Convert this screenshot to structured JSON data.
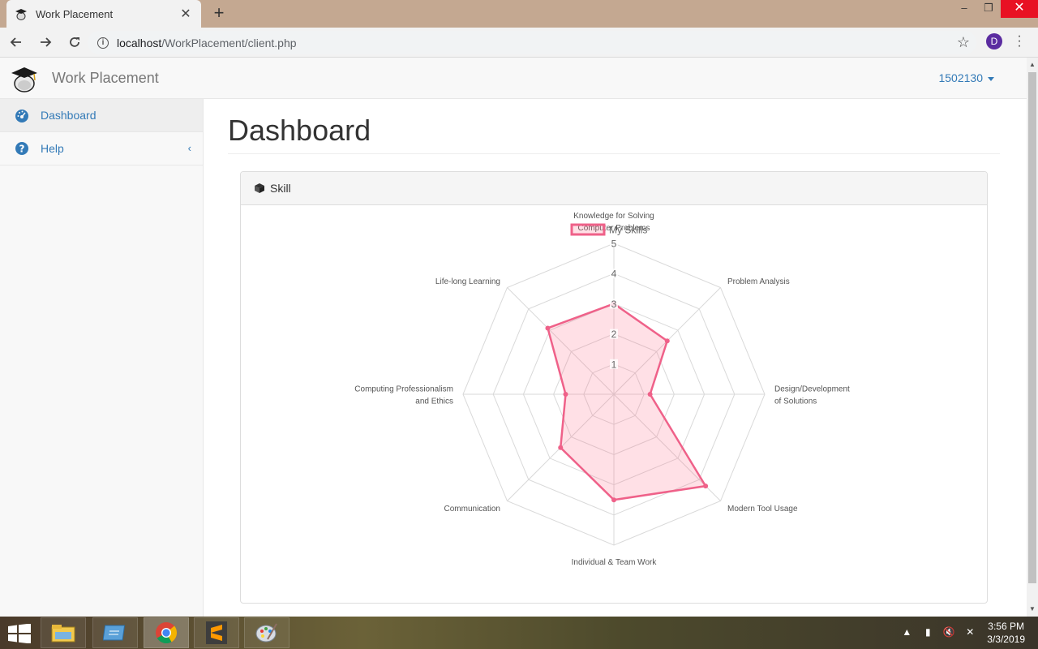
{
  "browser": {
    "tab_title": "Work Placement",
    "url_host": "localhost",
    "url_path": "/WorkPlacement/client.php",
    "profile_initial": "D"
  },
  "navbar": {
    "brand": "Work Placement",
    "user": "1502130"
  },
  "sidebar": {
    "items": [
      {
        "label": "Dashboard",
        "icon": "dashboard-icon"
      },
      {
        "label": "Help",
        "icon": "question-circle-icon"
      }
    ]
  },
  "main": {
    "title": "Dashboard",
    "panel_title": "Skill"
  },
  "chart_data": {
    "type": "radar",
    "axes": [
      [
        "Knowledge for Solving",
        "Computer Problems"
      ],
      [
        "Problem Analysis"
      ],
      [
        "Design/Development",
        "of Solutions"
      ],
      [
        "Modern Tool Usage"
      ],
      [
        "Individual & Team Work"
      ],
      [
        "Communication"
      ],
      [
        "Computing Professionalism",
        "and Ethics"
      ],
      [
        "Life-long Learning"
      ]
    ],
    "ticks": [
      "1",
      "2",
      "3",
      "4",
      "5"
    ],
    "rlim": [
      0,
      5
    ],
    "series": [
      {
        "name": "My Skills",
        "values": [
          3,
          2.5,
          1.2,
          4.3,
          3.5,
          2.5,
          1.6,
          3.1
        ],
        "color": "#ef6189",
        "fill": "rgba(255, 99, 132, 0.2)"
      }
    ],
    "legend": "top"
  },
  "taskbar": {
    "time": "3:56 PM",
    "date": "3/3/2019"
  }
}
